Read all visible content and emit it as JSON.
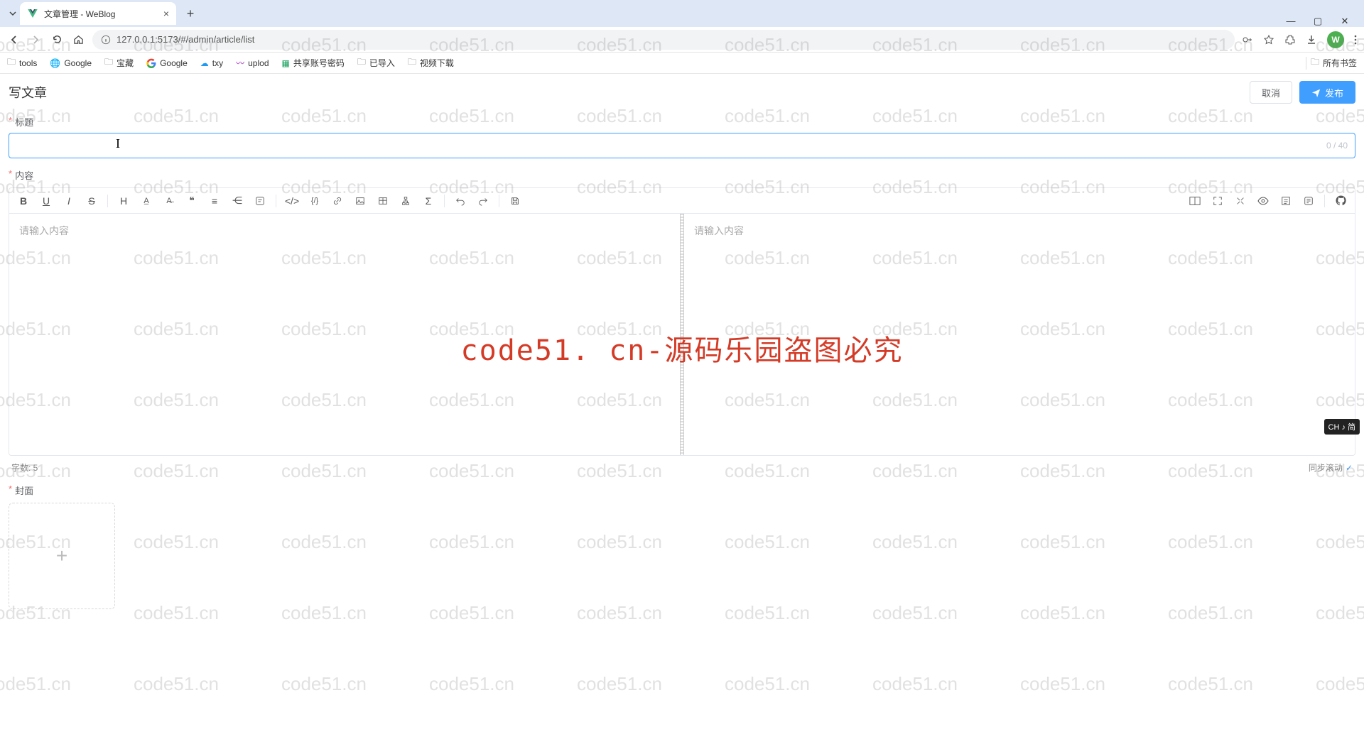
{
  "browser": {
    "tab_title": "文章管理 - WeBlog",
    "url": "127.0.0.1:5173/#/admin/article/list",
    "bookmarks": [
      "tools",
      "Google",
      "宝藏",
      "Google",
      "txy",
      "uplod",
      "共享账号密码",
      "已导入",
      "视频下载"
    ],
    "all_bookmarks": "所有书签",
    "avatar_letter": "W"
  },
  "page": {
    "title": "写文章",
    "cancel": "取消",
    "publish": "发布"
  },
  "form": {
    "title_label": "标题",
    "title_counter": "0 / 40",
    "content_label": "内容",
    "editor_placeholder_left": "请输入内容",
    "editor_placeholder_right": "请输入内容",
    "word_count": "字数: 5",
    "sync_scroll": "同步滚动",
    "cover_label": "封面"
  },
  "watermark": {
    "repeat": "code51.cn",
    "center": "code51. cn-源码乐园盗图必究"
  },
  "ime": "CH ♪ 简"
}
